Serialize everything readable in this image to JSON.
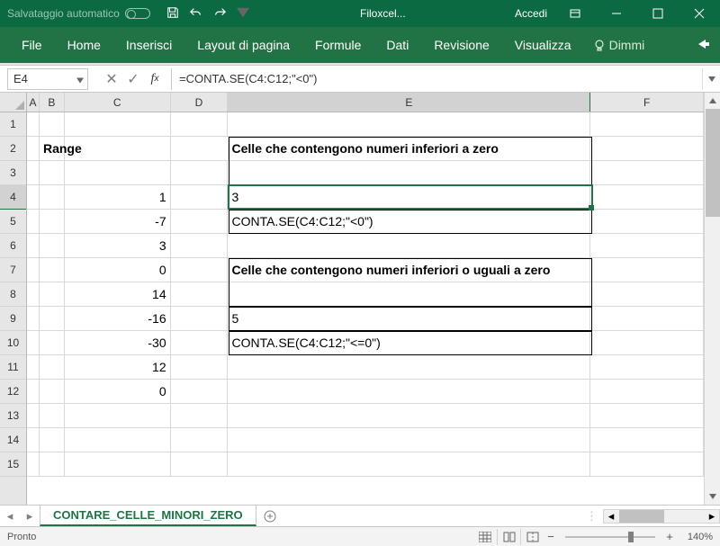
{
  "titlebar": {
    "autosave": "Salvataggio automatico",
    "doc": "Filoxcel...",
    "signin": "Accedi"
  },
  "ribbon": {
    "file": "File",
    "home": "Home",
    "inserisci": "Inserisci",
    "layout": "Layout di pagina",
    "formule": "Formule",
    "dati": "Dati",
    "revisione": "Revisione",
    "visualizza": "Visualizza",
    "dimmi": "Dimmi"
  },
  "fbar": {
    "namebox": "E4",
    "formula": "=CONTA.SE(C4:C12;\"<0\")"
  },
  "cols": {
    "A": "A",
    "B": "B",
    "C": "C",
    "D": "D",
    "E": "E",
    "F": "F"
  },
  "rows": [
    "1",
    "2",
    "3",
    "4",
    "5",
    "6",
    "7",
    "8",
    "9",
    "10",
    "11",
    "12",
    "13",
    "14",
    "15"
  ],
  "cells": {
    "B2": "Range",
    "E2": "Celle che contengono numeri inferiori a zero",
    "C4": "1",
    "C5": "-7",
    "C6": "3",
    "C7": "0",
    "C8": "14",
    "C9": "-16",
    "C10": "-30",
    "C11": "12",
    "C12": "0",
    "E4": "3",
    "E5": "CONTA.SE(C4:C12;\"<0\")",
    "E7": "Celle che contengono numeri inferiori o uguali a zero",
    "E9": "5",
    "E10": "CONTA.SE(C4:C12;\"<=0\")"
  },
  "sheet": {
    "name": "CONTARE_CELLE_MINORI_ZERO"
  },
  "status": {
    "ready": "Pronto",
    "zoom": "140%"
  }
}
